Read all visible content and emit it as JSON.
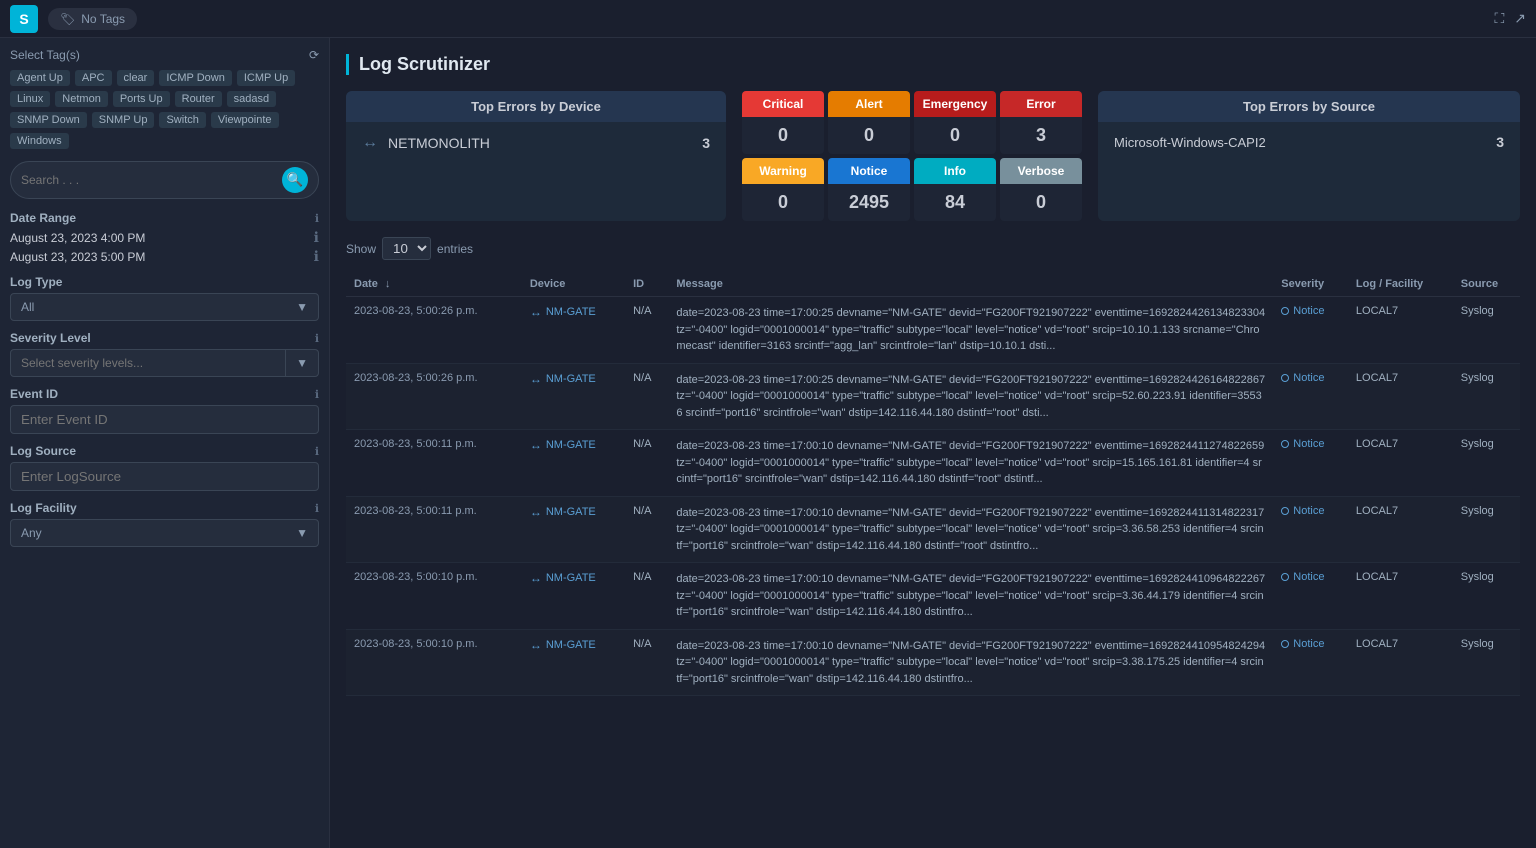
{
  "topbar": {
    "logo": "S",
    "tags_label": "No Tags",
    "fullscreen_icon": "⛶",
    "exit_icon": "⬡"
  },
  "sidebar": {
    "select_tags_label": "Select Tag(s)",
    "tags": [
      {
        "label": "Agent Up",
        "id": "agent-up"
      },
      {
        "label": "APC",
        "id": "apc"
      },
      {
        "label": "clear",
        "id": "clear"
      },
      {
        "label": "ICMP Down",
        "id": "icmp-down"
      },
      {
        "label": "ICMP Up",
        "id": "icmp-up"
      },
      {
        "label": "Linux",
        "id": "linux"
      },
      {
        "label": "Netmon",
        "id": "netmon"
      },
      {
        "label": "Ports Up",
        "id": "ports-up"
      },
      {
        "label": "Router",
        "id": "router"
      },
      {
        "label": "sadasd",
        "id": "sadasd"
      },
      {
        "label": "SNMP Down",
        "id": "snmp-down"
      },
      {
        "label": "SNMP Up",
        "id": "snmp-up"
      },
      {
        "label": "Switch",
        "id": "switch"
      },
      {
        "label": "Viewpointe",
        "id": "viewpointe"
      },
      {
        "label": "Windows",
        "id": "windows"
      }
    ],
    "search_placeholder": "Search . . .",
    "date_range_label": "Date Range",
    "date_from": "August 23, 2023 4:00 PM",
    "date_to": "August 23, 2023 5:00 PM",
    "log_type_label": "Log Type",
    "log_type_value": "All",
    "severity_level_label": "Severity Level",
    "severity_placeholder": "Select severity levels...",
    "event_id_label": "Event ID",
    "event_id_placeholder": "Enter Event ID",
    "log_source_label": "Log Source",
    "log_source_placeholder": "Enter LogSource",
    "log_facility_label": "Log Facility",
    "log_facility_value": "Any"
  },
  "content": {
    "page_title": "Log Scrutinizer",
    "top_errors_device_title": "Top Errors by Device",
    "device_rows": [
      {
        "name": "NETMONOLITH",
        "count": "3"
      }
    ],
    "severity_cards": [
      {
        "label": "Critical",
        "value": "0",
        "class": "sev-critical"
      },
      {
        "label": "Alert",
        "value": "0",
        "class": "sev-alert"
      },
      {
        "label": "Emergency",
        "value": "0",
        "class": "sev-emergency"
      },
      {
        "label": "Error",
        "value": "3",
        "class": "sev-error"
      },
      {
        "label": "Warning",
        "value": "0",
        "class": "sev-warning"
      },
      {
        "label": "Notice",
        "value": "2495",
        "class": "sev-notice"
      },
      {
        "label": "Info",
        "value": "84",
        "class": "sev-info"
      },
      {
        "label": "Verbose",
        "value": "0",
        "class": "sev-verbose"
      }
    ],
    "top_errors_source_title": "Top Errors by Source",
    "source_rows": [
      {
        "name": "Microsoft-Windows-CAPI2",
        "count": "3"
      }
    ],
    "show_label": "Show",
    "entries_value": "10",
    "entries_label": "entries",
    "table_headers": [
      "Date",
      "Device",
      "ID",
      "Message",
      "Severity",
      "Log / Facility",
      "Source"
    ],
    "log_rows": [
      {
        "date": "2023-08-23, 5:00:26 p.m.",
        "device": "NM-GATE",
        "id": "N/A",
        "message": "date=2023-08-23 time=17:00:25 devname=\"NM-GATE\" devid=\"FG200FT921907222\" eventtime=1692824426134823304 tz=\"-0400\" logid=\"0001000014\" type=\"traffic\" subtype=\"local\" level=\"notice\" vd=\"root\" srcip=10.10.1.133 srcname=\"Chromecast\" identifier=3163 srcintf=\"agg_lan\" srcintfrole=\"lan\" dstip=10.10.1 dsti...",
        "severity": "Notice",
        "facility": "LOCAL7",
        "source": "Syslog"
      },
      {
        "date": "2023-08-23, 5:00:26 p.m.",
        "device": "NM-GATE",
        "id": "N/A",
        "message": "date=2023-08-23 time=17:00:25 devname=\"NM-GATE\" devid=\"FG200FT921907222\" eventtime=1692824426164822867 tz=\"-0400\" logid=\"0001000014\" type=\"traffic\" subtype=\"local\" level=\"notice\" vd=\"root\" srcip=52.60.223.91 identifier=35536 srcintf=\"port16\" srcintfrole=\"wan\" dstip=142.116.44.180 dstintf=\"root\" dsti...",
        "severity": "Notice",
        "facility": "LOCAL7",
        "source": "Syslog"
      },
      {
        "date": "2023-08-23, 5:00:11 p.m.",
        "device": "NM-GATE",
        "id": "N/A",
        "message": "date=2023-08-23 time=17:00:10 devname=\"NM-GATE\" devid=\"FG200FT921907222\" eventtime=1692824411274822659 tz=\"-0400\" logid=\"0001000014\" type=\"traffic\" subtype=\"local\" level=\"notice\" vd=\"root\" srcip=15.165.161.81 identifier=4 srcintf=\"port16\" srcintfrole=\"wan\" dstip=142.116.44.180 dstintf=\"root\" dstintf...",
        "severity": "Notice",
        "facility": "LOCAL7",
        "source": "Syslog"
      },
      {
        "date": "2023-08-23, 5:00:11 p.m.",
        "device": "NM-GATE",
        "id": "N/A",
        "message": "date=2023-08-23 time=17:00:10 devname=\"NM-GATE\" devid=\"FG200FT921907222\" eventtime=1692824411314822317 tz=\"-0400\" logid=\"0001000014\" type=\"traffic\" subtype=\"local\" level=\"notice\" vd=\"root\" srcip=3.36.58.253 identifier=4 srcintf=\"port16\" srcintfrole=\"wan\" dstip=142.116.44.180 dstintf=\"root\" dstintfro...",
        "severity": "Notice",
        "facility": "LOCAL7",
        "source": "Syslog"
      },
      {
        "date": "2023-08-23, 5:00:10 p.m.",
        "device": "NM-GATE",
        "id": "N/A",
        "message": "date=2023-08-23 time=17:00:10 devname=\"NM-GATE\" devid=\"FG200FT921907222\" eventtime=1692824410964822267 tz=\"-0400\" logid=\"0001000014\" type=\"traffic\" subtype=\"local\" level=\"notice\" vd=\"root\" srcip=3.36.44.179 identifier=4 srcintf=\"port16\" srcintfrole=\"wan\" dstip=142.116.44.180 dstintfro...",
        "severity": "Notice",
        "facility": "LOCAL7",
        "source": "Syslog"
      },
      {
        "date": "2023-08-23, 5:00:10 p.m.",
        "device": "NM-GATE",
        "id": "N/A",
        "message": "date=2023-08-23 time=17:00:10 devname=\"NM-GATE\" devid=\"FG200FT921907222\" eventtime=1692824410954824294 tz=\"-0400\" logid=\"0001000014\" type=\"traffic\" subtype=\"local\" level=\"notice\" vd=\"root\" srcip=3.38.175.25 identifier=4 srcintf=\"port16\" srcintfrole=\"wan\" dstip=142.116.44.180 dstintfro...",
        "severity": "Notice",
        "facility": "LOCAL7",
        "source": "Syslog"
      }
    ]
  }
}
